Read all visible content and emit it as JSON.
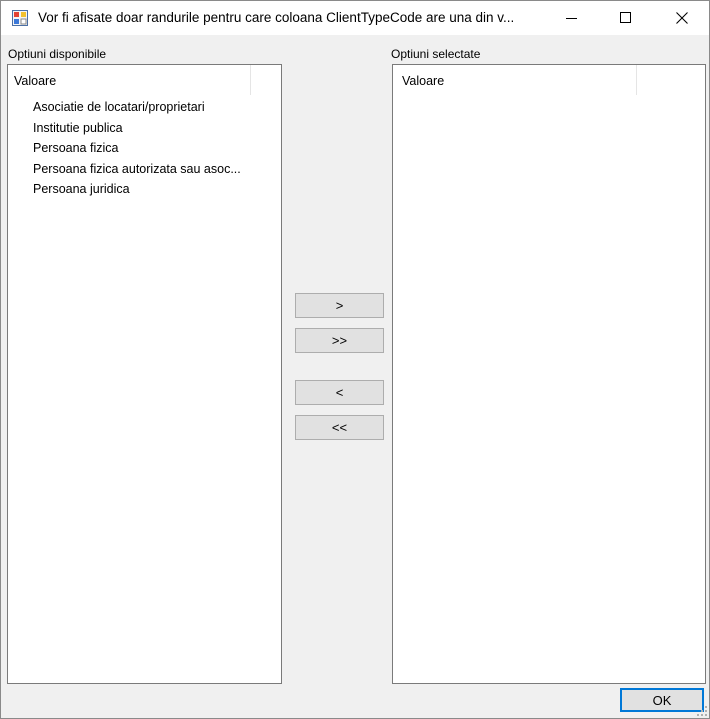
{
  "window": {
    "title": "Vor fi afisate doar randurile pentru care coloana ClientTypeCode are una din v..."
  },
  "available": {
    "label": "Optiuni disponibile",
    "column_header": "Valoare",
    "items": [
      "Asociatie de locatari/proprietari",
      "Institutie publica",
      "Persoana fizica",
      "Persoana fizica autorizata sau asoc...",
      "Persoana juridica"
    ]
  },
  "selected": {
    "label": "Optiuni selectate",
    "column_header": "Valoare",
    "items": []
  },
  "buttons": {
    "move_one": ">",
    "move_all": ">>",
    "remove_one": "<",
    "remove_all": "<<",
    "ok": "OK"
  }
}
